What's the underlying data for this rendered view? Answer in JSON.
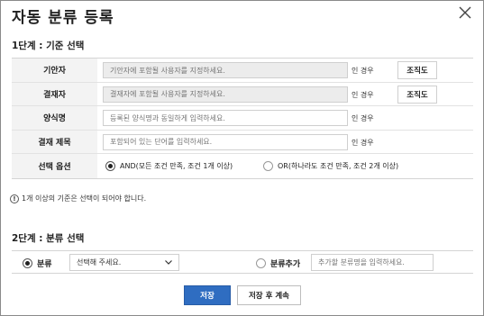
{
  "dialog": {
    "title": "자동 분류 등록"
  },
  "step1": {
    "title": "1단계 : 기준 선택",
    "rows": [
      {
        "label": "기안자",
        "placeholder": "기안자에 포함될 사용자를 지정하세요.",
        "suffix": "인 경우",
        "button": "조직도"
      },
      {
        "label": "결재자",
        "placeholder": "결재자에 포함될 사용자를 지정하세요.",
        "suffix": "인 경우",
        "button": "조직도"
      },
      {
        "label": "양식명",
        "placeholder": "등록된 양식명과 동일하게 입력하세요.",
        "suffix": "인 경우"
      },
      {
        "label": "결재 제목",
        "placeholder": "포함되어 있는 단어를 입력하세요.",
        "suffix": "인 경우"
      }
    ],
    "options": {
      "label": "선택 옵션",
      "and": "AND(모든 조건 만족, 조건 1개 이상)",
      "or": "OR(하나라도 조건 만족, 조건 2개 이상)"
    },
    "notice": "1개 이상의 기준은 선택이 되어야 합니다."
  },
  "step2": {
    "title": "2단계 : 분류 선택",
    "classify_label": "분류",
    "select_value": "선택해 주세요.",
    "add_label": "분류추가",
    "add_placeholder": "추가할 분류명을 입력하세요."
  },
  "footer": {
    "save": "저장",
    "save_continue": "저장 후 계속"
  }
}
